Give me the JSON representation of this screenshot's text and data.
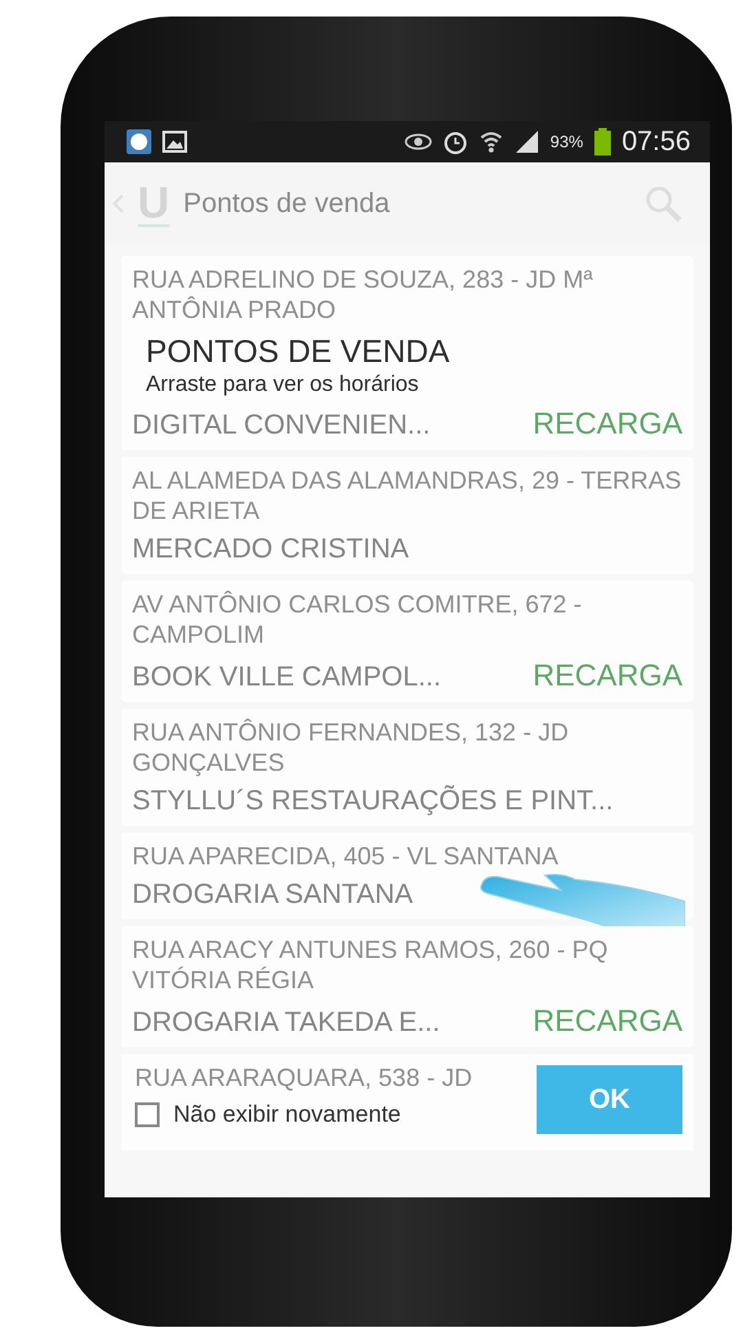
{
  "status_bar": {
    "battery": "93%",
    "time": "07:56"
  },
  "app_bar": {
    "logo": "U",
    "title": "Pontos de venda"
  },
  "stores": [
    {
      "address": "RUA ADRELINO DE SOUZA, 283 - JD Mª ANTÔNIA PRADO",
      "name": "DIGITAL CONVENIEN...",
      "badge": "RECARGA"
    },
    {
      "address": "AL ALAMEDA DAS ALAMANDRAS, 29 - TERRAS DE ARIETA",
      "name": "MERCADO CRISTINA"
    },
    {
      "address": "AV ANTÔNIO CARLOS COMITRE, 672 - CAMPOLIM",
      "name": "BOOK VILLE CAMPOL...",
      "badge": "RECARGA"
    },
    {
      "address": "RUA ANTÔNIO FERNANDES, 132 - JD GONÇALVES",
      "name": "STYLLU´S RESTAURAÇÕES E PINT..."
    },
    {
      "address": "RUA APARECIDA, 405 - VL SANTANA",
      "name": "DROGARIA SANTANA"
    },
    {
      "address": "RUA ARACY ANTUNES RAMOS, 260 - PQ VITÓRIA RÉGIA",
      "name": "DROGARIA TAKEDA E...",
      "badge": "RECARGA"
    },
    {
      "address": "RUA ARARAQUARA, 538 - JD"
    }
  ],
  "coach": {
    "title": "PONTOS DE VENDA",
    "subtitle": "Arraste para ver os horários",
    "checkbox": {
      "label": "Não exibir novamente",
      "checked": false
    },
    "button": "OK"
  }
}
